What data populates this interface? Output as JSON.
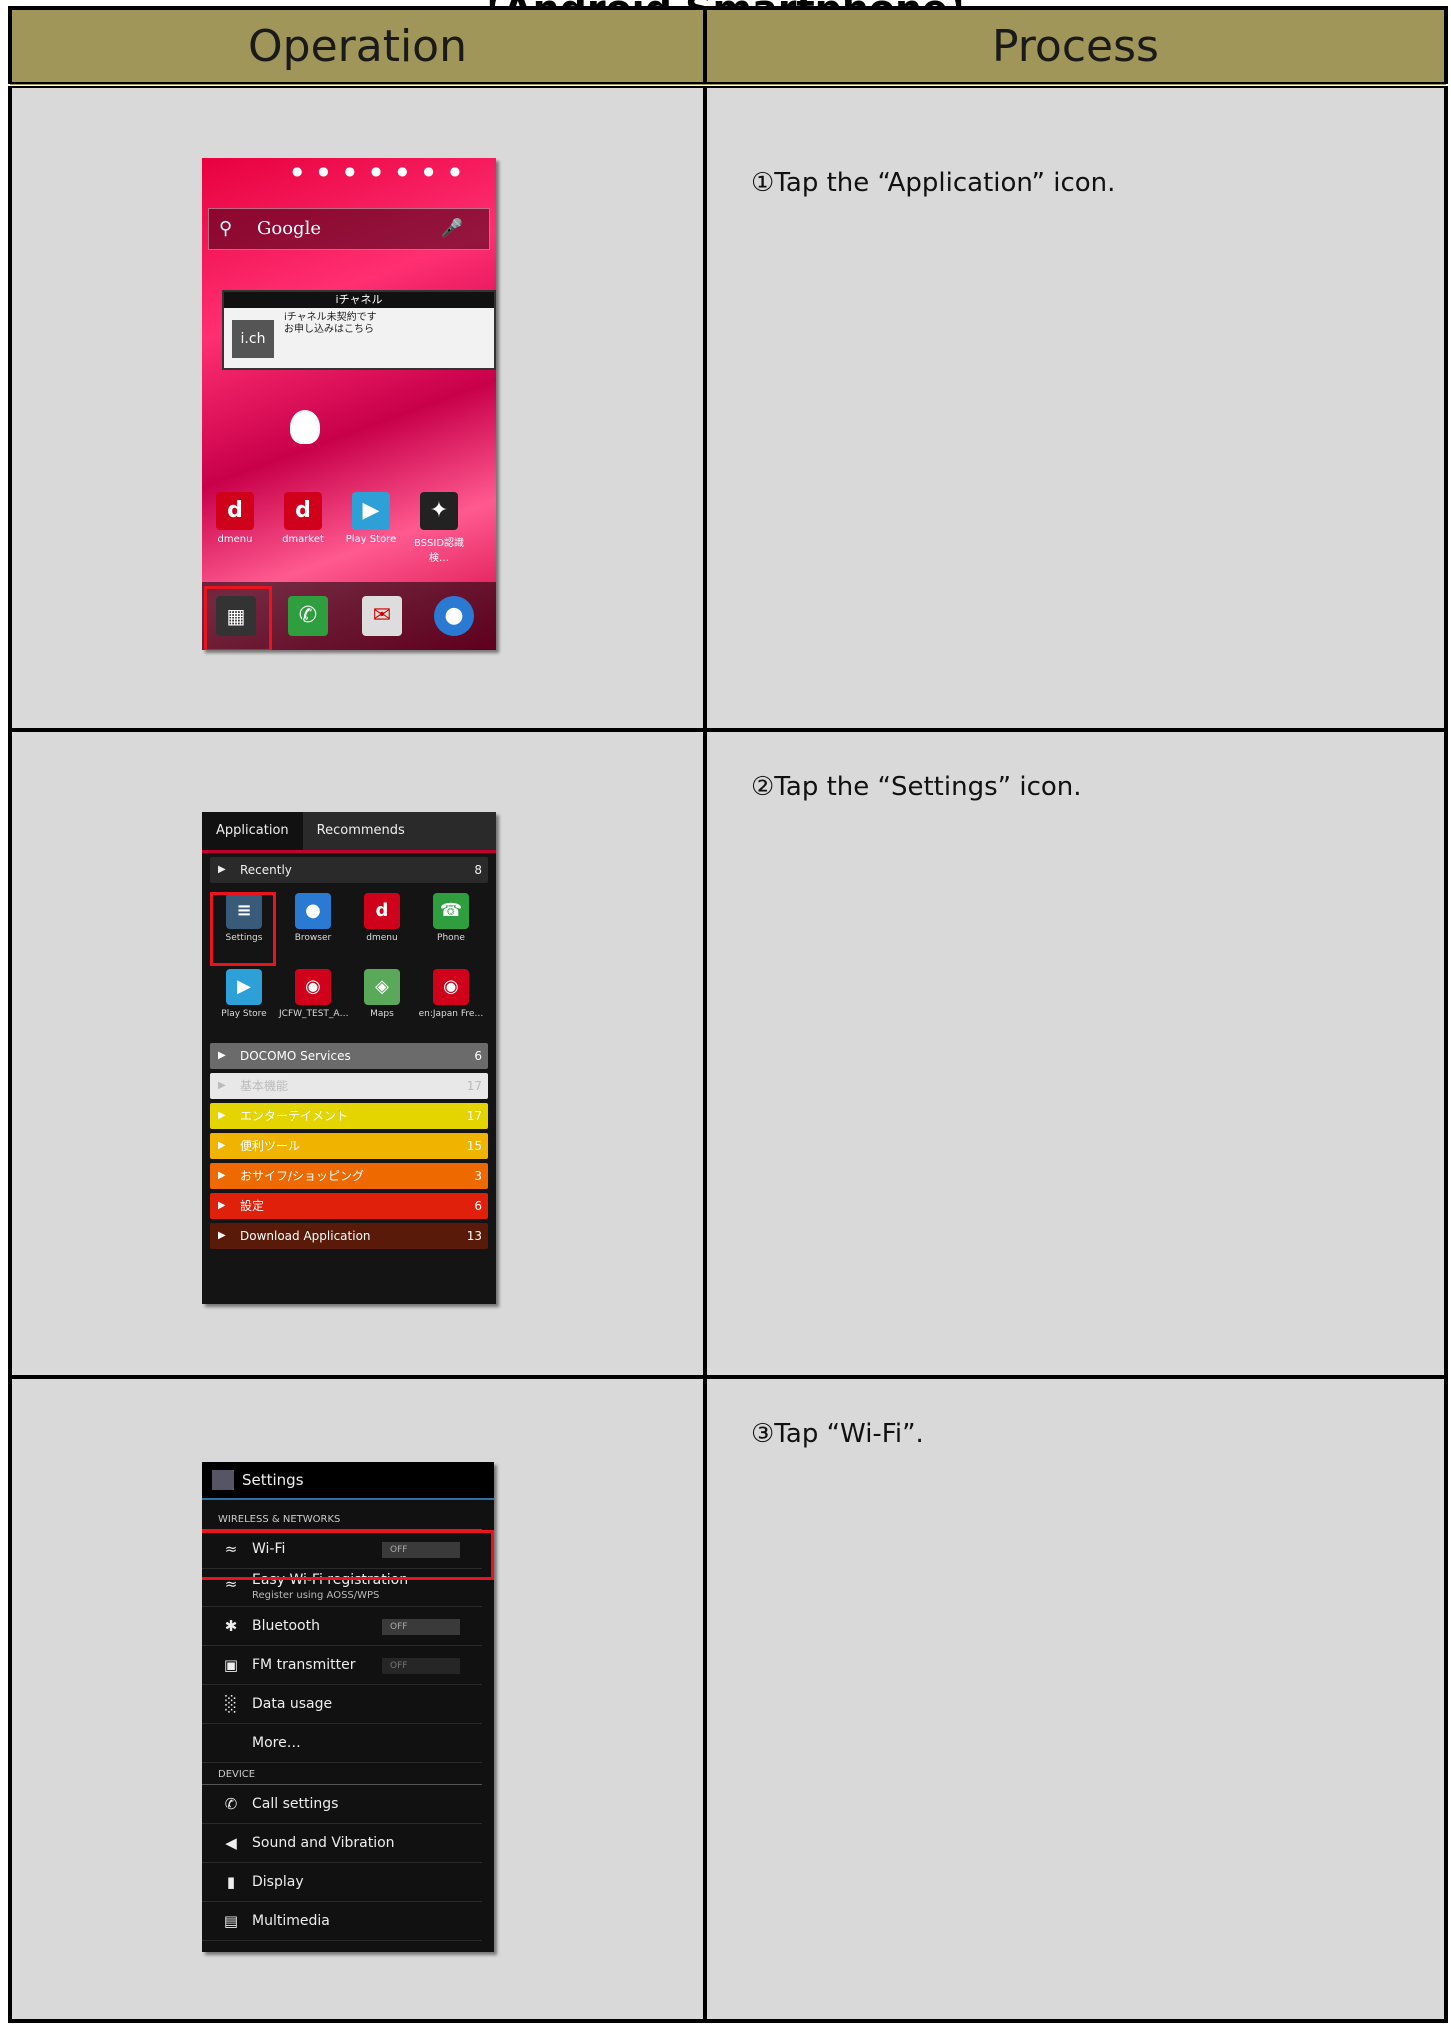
{
  "document": {
    "title": "【Android Smartphone】"
  },
  "table": {
    "headers": {
      "operation": "Operation",
      "process": "Process"
    },
    "steps": [
      {
        "process": "①Tap the “Application” icon."
      },
      {
        "process": "②Tap the “Settings” icon."
      },
      {
        "process": "③Tap “Wi-Fi”."
      }
    ]
  },
  "screen1": {
    "search_label": "Google",
    "widget_title": "iチャネル",
    "widget_logo": "i.ch",
    "widget_text_1": "iチャネル未契約です",
    "widget_text_2": "お申し込みはこちら",
    "apps": [
      {
        "label": "dmenu",
        "glyph": "d",
        "color": "#d0021b"
      },
      {
        "label": "dmarket",
        "glyph": "d",
        "color": "#d0021b"
      },
      {
        "label": "Play Store",
        "glyph": "▶",
        "color": "#2ea0d8"
      },
      {
        "label": "BSSID認識検…",
        "glyph": "✦",
        "color": "#222222"
      }
    ]
  },
  "screen2": {
    "tabs": [
      "Application",
      "Recommends"
    ],
    "recent_label": "Recently",
    "recent_count": "8",
    "apps_row1": [
      "Settings",
      "Browser",
      "dmenu",
      "Phone"
    ],
    "apps_row2": [
      "Play Store",
      "JCFW_TEST_A…",
      "Maps",
      "en:Japan Fre…"
    ],
    "groups": [
      {
        "label": "DOCOMO Services",
        "count": "6",
        "color": "#6b6b6b"
      },
      {
        "label": "基本機能",
        "count": "17",
        "color": "#e8e8e8"
      },
      {
        "label": "エンターテイメント",
        "count": "17",
        "color": "#e4d400"
      },
      {
        "label": "便利ツール",
        "count": "15",
        "color": "#f0b400"
      },
      {
        "label": "おサイフ/ショッピング",
        "count": "3",
        "color": "#ee6a00"
      },
      {
        "label": "設定",
        "count": "6",
        "color": "#e0200a"
      },
      {
        "label": "Download Application",
        "count": "13",
        "color": "#5a1a0a"
      }
    ]
  },
  "screen3": {
    "title": "Settings",
    "section_wireless": "WIRELESS & NETWORKS",
    "wifi": "Wi-Fi",
    "easy_wifi": "Easy Wi-Fi registration",
    "easy_wifi_sub": "Register using AOSS/WPS",
    "bluetooth": "Bluetooth",
    "fm": "FM transmitter",
    "data_usage": "Data usage",
    "more": "More…",
    "section_device": "DEVICE",
    "call_settings": "Call settings",
    "sound": "Sound and Vibration",
    "display": "Display",
    "multimedia": "Multimedia",
    "toggle_off": "OFF"
  }
}
